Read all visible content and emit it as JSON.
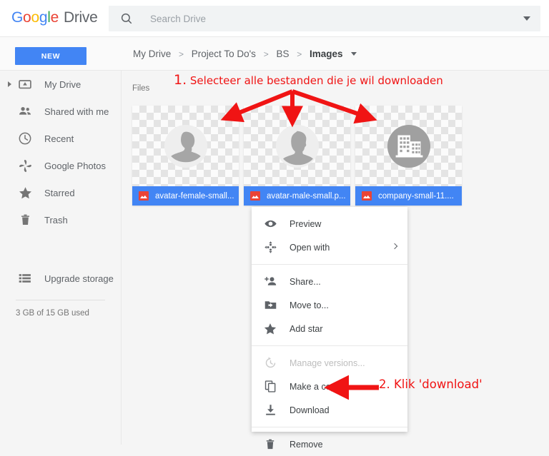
{
  "app": {
    "logo_google": "Google",
    "logo_product": "Drive"
  },
  "search": {
    "placeholder": "Search Drive",
    "value": "",
    "icon": "search-icon",
    "dropdown_icon": "chevron-down-icon"
  },
  "toolbar": {
    "new_label": "NEW"
  },
  "breadcrumb": {
    "items": [
      {
        "label": "My Drive"
      },
      {
        "label": "Project To Do's"
      },
      {
        "label": "BS"
      },
      {
        "label": "Images"
      }
    ],
    "separator": ">",
    "dropdown_icon": "chevron-down-icon"
  },
  "sidebar": {
    "items": [
      {
        "label": "My Drive",
        "icon": "drive-icon",
        "expandable": true
      },
      {
        "label": "Shared with me",
        "icon": "people-icon"
      },
      {
        "label": "Recent",
        "icon": "clock-icon"
      },
      {
        "label": "Google Photos",
        "icon": "photos-pinwheel-icon"
      },
      {
        "label": "Starred",
        "icon": "star-icon"
      },
      {
        "label": "Trash",
        "icon": "trash-icon"
      }
    ],
    "storage_text": "3 GB of 15 GB used",
    "upgrade": {
      "label": "Upgrade storage",
      "icon": "storage-bars-icon"
    }
  },
  "main": {
    "section_label": "Files",
    "files": [
      {
        "name": "avatar-female-small...",
        "thumb": "avatar-female-icon",
        "selected": true,
        "type_icon": "image-file-icon"
      },
      {
        "name": "avatar-male-small.p...",
        "thumb": "avatar-male-icon",
        "selected": true,
        "type_icon": "image-file-icon"
      },
      {
        "name": "company-small-11....",
        "thumb": "company-building-icon",
        "selected": true,
        "type_icon": "image-file-icon"
      }
    ]
  },
  "context_menu": {
    "groups": [
      [
        {
          "label": "Preview",
          "icon": "eye-icon",
          "disabled": false,
          "submenu": false
        },
        {
          "label": "Open with",
          "icon": "open-with-icon",
          "disabled": false,
          "submenu": true
        }
      ],
      [
        {
          "label": "Share...",
          "icon": "add-person-icon",
          "disabled": false,
          "submenu": false
        },
        {
          "label": "Move to...",
          "icon": "move-folder-icon",
          "disabled": false,
          "submenu": false
        },
        {
          "label": "Add star",
          "icon": "star-icon",
          "disabled": false,
          "submenu": false
        }
      ],
      [
        {
          "label": "Manage versions...",
          "icon": "history-icon",
          "disabled": true,
          "submenu": false
        },
        {
          "label": "Make a copy",
          "icon": "copy-icon",
          "disabled": false,
          "submenu": false
        },
        {
          "label": "Download",
          "icon": "download-icon",
          "disabled": false,
          "submenu": false
        }
      ],
      [
        {
          "label": "Remove",
          "icon": "trash-icon",
          "disabled": false,
          "submenu": false
        }
      ]
    ]
  },
  "annotations": {
    "step1_number": "1.",
    "step1_text": " Selecteer alle bestanden die je wil downloaden",
    "step2_text": "2. Klik 'download'",
    "color": "#f01414"
  },
  "colors": {
    "accent_blue": "#4285f4",
    "selection_blue": "#4285f4",
    "annotation_red": "#f01414",
    "page_bg": "#f5f5f5",
    "topbar_bg": "#ffffff"
  }
}
